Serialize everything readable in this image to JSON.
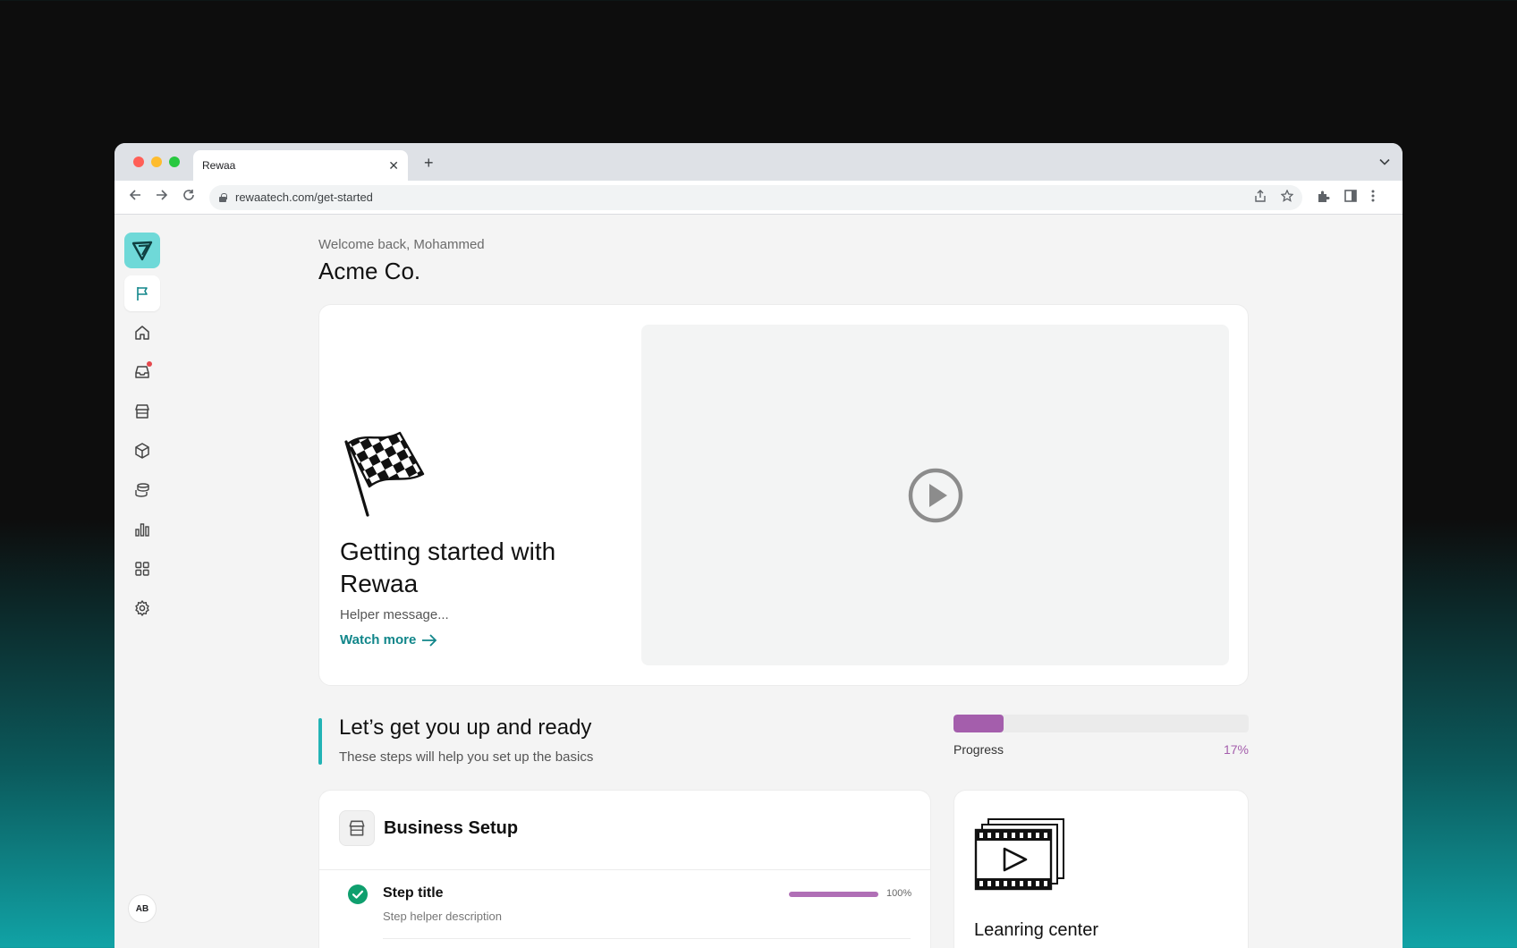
{
  "browser": {
    "tab_title": "Rewaa",
    "tab_close": "✕",
    "new_tab": "+",
    "url": "rewaatech.com/get-started",
    "traffic_lights": [
      "#ff5f57",
      "#febc2e",
      "#28c840"
    ]
  },
  "sidebar": {
    "items": [
      {
        "name": "flag-icon",
        "active": true
      },
      {
        "name": "home-icon",
        "active": false
      },
      {
        "name": "inbox-icon",
        "active": false,
        "badge": true
      },
      {
        "name": "store-icon",
        "active": false
      },
      {
        "name": "box-icon",
        "active": false
      },
      {
        "name": "coins-icon",
        "active": false
      },
      {
        "name": "bar-chart-icon",
        "active": false
      },
      {
        "name": "apps-grid-icon",
        "active": false
      },
      {
        "name": "gear-icon",
        "active": false
      }
    ],
    "avatar_initials": "AB"
  },
  "header": {
    "welcome": "Welcome back, Mohammed",
    "company": "Acme Co."
  },
  "hero": {
    "title": "Getting started with Rewaa",
    "helper": "Helper message...",
    "watch_more": "Watch more"
  },
  "ready": {
    "title": "Let’s get you up and ready",
    "subtitle": "These steps will help you set up the basics",
    "progress_label": "Progress",
    "progress_value": "17%",
    "progress_fraction": 0.17
  },
  "business_setup": {
    "title": "Business Setup",
    "steps": [
      {
        "title": "Step title",
        "description": "Step helper description",
        "percent_label": "100%",
        "fraction": 1.0,
        "done": true
      }
    ]
  },
  "learning": {
    "title": "Leanring center"
  },
  "colors": {
    "accent": "#11868a",
    "brand_logo": "#6fd9d8",
    "progress": "#a45eac",
    "success": "#16a34a"
  }
}
